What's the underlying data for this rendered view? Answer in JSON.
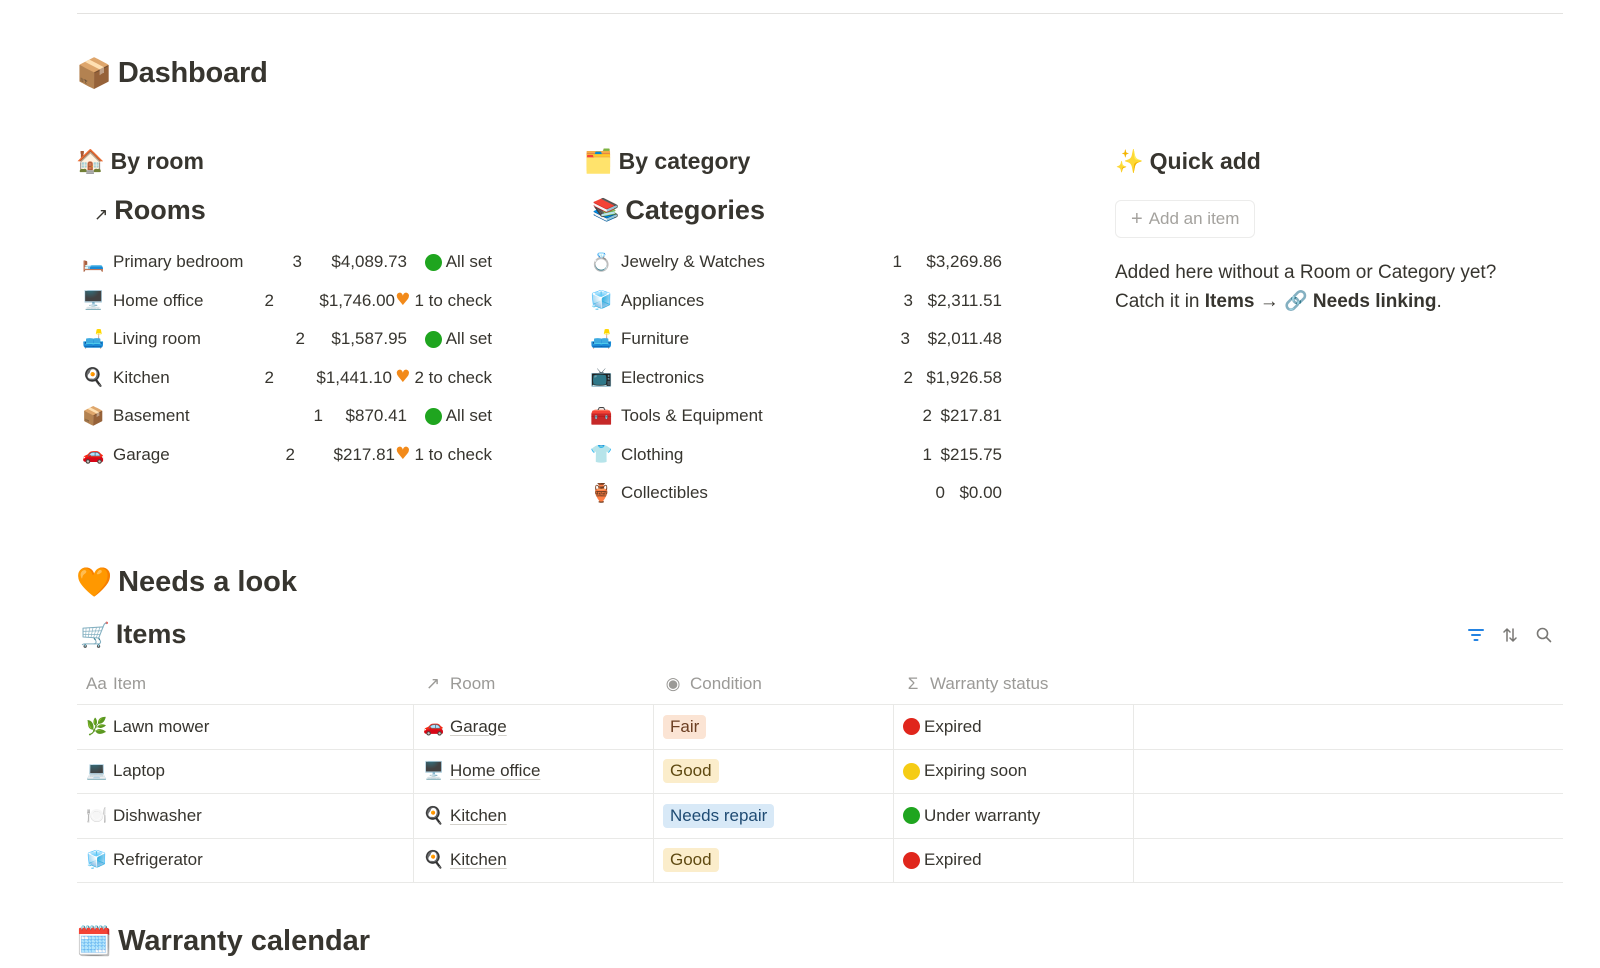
{
  "page": {
    "title": "Dashboard",
    "icon": "📦"
  },
  "by_room": {
    "heading": "By room",
    "icon": "🏠",
    "db_title": "Rooms",
    "rows": [
      {
        "icon": "🛏️",
        "name": "Primary bedroom",
        "count": "3",
        "value": "$4,089.73",
        "status": "All set",
        "status_kind": "green"
      },
      {
        "icon": "🖥️",
        "name": "Home office",
        "count": "2",
        "value": "$1,746.00",
        "status": "1 to check",
        "status_kind": "heart"
      },
      {
        "icon": "🛋️",
        "name": "Living room",
        "count": "2",
        "value": "$1,587.95",
        "status": "All set",
        "status_kind": "green"
      },
      {
        "icon": "🍳",
        "name": "Kitchen",
        "count": "2",
        "value": "$1,441.10",
        "status": "2 to check",
        "status_kind": "heart"
      },
      {
        "icon": "📦",
        "name": "Basement",
        "count": "1",
        "value": "$870.41",
        "status": "All set",
        "status_kind": "green"
      },
      {
        "icon": "🚗",
        "name": "Garage",
        "count": "2",
        "value": "$217.81",
        "status": "1 to check",
        "status_kind": "heart"
      }
    ]
  },
  "by_category": {
    "heading": "By category",
    "icon": "🗂️",
    "db_title": "Categories",
    "db_icon": "📚",
    "rows": [
      {
        "icon": "💍",
        "name": "Jewelry & Watches",
        "count": "1",
        "value": "$3,269.86"
      },
      {
        "icon": "🧊",
        "name": "Appliances",
        "count": "3",
        "value": "$2,311.51"
      },
      {
        "icon": "🛋️",
        "name": "Furniture",
        "count": "3",
        "value": "$2,011.48"
      },
      {
        "icon": "📺",
        "name": "Electronics",
        "count": "2",
        "value": "$1,926.58"
      },
      {
        "icon": "🧰",
        "name": "Tools & Equipment",
        "count": "2",
        "value": "$217.81"
      },
      {
        "icon": "👕",
        "name": "Clothing",
        "count": "1",
        "value": "$215.75"
      },
      {
        "icon": "🏺",
        "name": "Collectibles",
        "count": "0",
        "value": "$0.00"
      }
    ]
  },
  "quick_add": {
    "heading": "Quick add",
    "icon": "✨",
    "button_label": "Add an item",
    "note_line1": "Added here without a Room or Category yet?",
    "note_line2_prefix": "Catch it in ",
    "note_items": "Items",
    "note_arrow": "→",
    "note_link_icon": "🔗",
    "note_link": "Needs linking",
    "note_end": "."
  },
  "needs_look": {
    "heading": "Needs a look",
    "icon": "🧡",
    "db_title": "Items",
    "db_icon": "🛒",
    "columns": [
      {
        "icon": "Aa",
        "label": "Item"
      },
      {
        "icon": "↗",
        "label": "Room"
      },
      {
        "icon": "◉",
        "label": "Condition"
      },
      {
        "icon": "Σ",
        "label": "Warranty status"
      }
    ],
    "rows": [
      {
        "icon": "🌿",
        "item": "Lawn mower",
        "room_icon": "🚗",
        "room": "Garage",
        "condition": "Fair",
        "cond_bg": "#fbe4d4",
        "cond_fg": "#6b3e22",
        "warranty": "Expired",
        "warranty_dot": "#e0261c"
      },
      {
        "icon": "💻",
        "item": "Laptop",
        "room_icon": "🖥️",
        "room": "Home office",
        "condition": "Good",
        "cond_bg": "#fbedcb",
        "cond_fg": "#5f4a12",
        "warranty": "Expiring soon",
        "warranty_dot": "#f5cc15"
      },
      {
        "icon": "🍽️",
        "item": "Dishwasher",
        "room_icon": "🍳",
        "room": "Kitchen",
        "condition": "Needs repair",
        "cond_bg": "#d8e9f7",
        "cond_fg": "#1f4b73",
        "warranty": "Under warranty",
        "warranty_dot": "#1fa51f"
      },
      {
        "icon": "🧊",
        "item": "Refrigerator",
        "room_icon": "🍳",
        "room": "Kitchen",
        "condition": "Good",
        "cond_bg": "#fbedcb",
        "cond_fg": "#5f4a12",
        "warranty": "Expired",
        "warranty_dot": "#e0261c"
      }
    ]
  },
  "warranty_calendar": {
    "heading": "Warranty calendar",
    "icon": "🗓️"
  },
  "colors": {
    "green": "#1fa51f",
    "heart": "#f28a1a",
    "accent_blue": "#2383e2"
  }
}
